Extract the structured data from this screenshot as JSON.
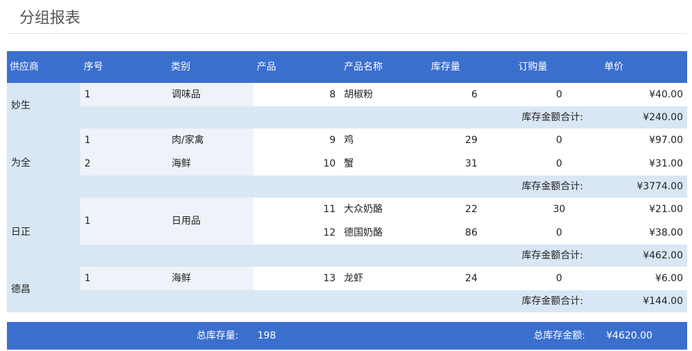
{
  "page": {
    "title": "分组报表"
  },
  "colors": {
    "header_bg": "#3b6fce",
    "subtotal_bg": "#d9e7f4",
    "label_cell_bg": "#eef3f9",
    "row_bg": "#ffffff"
  },
  "table": {
    "columns": [
      "供应商",
      "序号",
      "类别",
      "产品",
      "产品名称",
      "库存量",
      "订购量",
      "单价"
    ],
    "groups": [
      {
        "supplier": "妙生",
        "categories": [
          {
            "seq": "1",
            "category": "调味品",
            "items": [
              {
                "product_id": "8",
                "name": "胡椒粉",
                "stock": "6",
                "ordered": "0",
                "price": "¥40.00"
              }
            ]
          }
        ],
        "subtotal_label": "库存金额合计:",
        "subtotal": "¥240.00"
      },
      {
        "supplier": "为全",
        "categories": [
          {
            "seq": "1",
            "category": "肉/家禽",
            "items": [
              {
                "product_id": "9",
                "name": "鸡",
                "stock": "29",
                "ordered": "0",
                "price": "¥97.00"
              }
            ]
          },
          {
            "seq": "2",
            "category": "海鲜",
            "items": [
              {
                "product_id": "10",
                "name": "蟹",
                "stock": "31",
                "ordered": "0",
                "price": "¥31.00"
              }
            ]
          }
        ],
        "subtotal_label": "库存金额合计:",
        "subtotal": "¥3774.00"
      },
      {
        "supplier": "日正",
        "categories": [
          {
            "seq": "1",
            "category": "日用品",
            "items": [
              {
                "product_id": "11",
                "name": "大众奶酪",
                "stock": "22",
                "ordered": "30",
                "price": "¥21.00"
              },
              {
                "product_id": "12",
                "name": "德国奶酪",
                "stock": "86",
                "ordered": "0",
                "price": "¥38.00"
              }
            ]
          }
        ],
        "subtotal_label": "库存金额合计:",
        "subtotal": "¥462.00"
      },
      {
        "supplier": "德昌",
        "categories": [
          {
            "seq": "1",
            "category": "海鲜",
            "items": [
              {
                "product_id": "13",
                "name": "龙虾",
                "stock": "24",
                "ordered": "0",
                "price": "¥6.00"
              }
            ]
          }
        ],
        "subtotal_label": "库存金额合计:",
        "subtotal": "¥144.00"
      }
    ],
    "footer": {
      "total_stock_label": "总库存量:",
      "total_stock": "198",
      "total_amount_label": "总库存金额:",
      "total_amount": "¥4620.00"
    }
  }
}
